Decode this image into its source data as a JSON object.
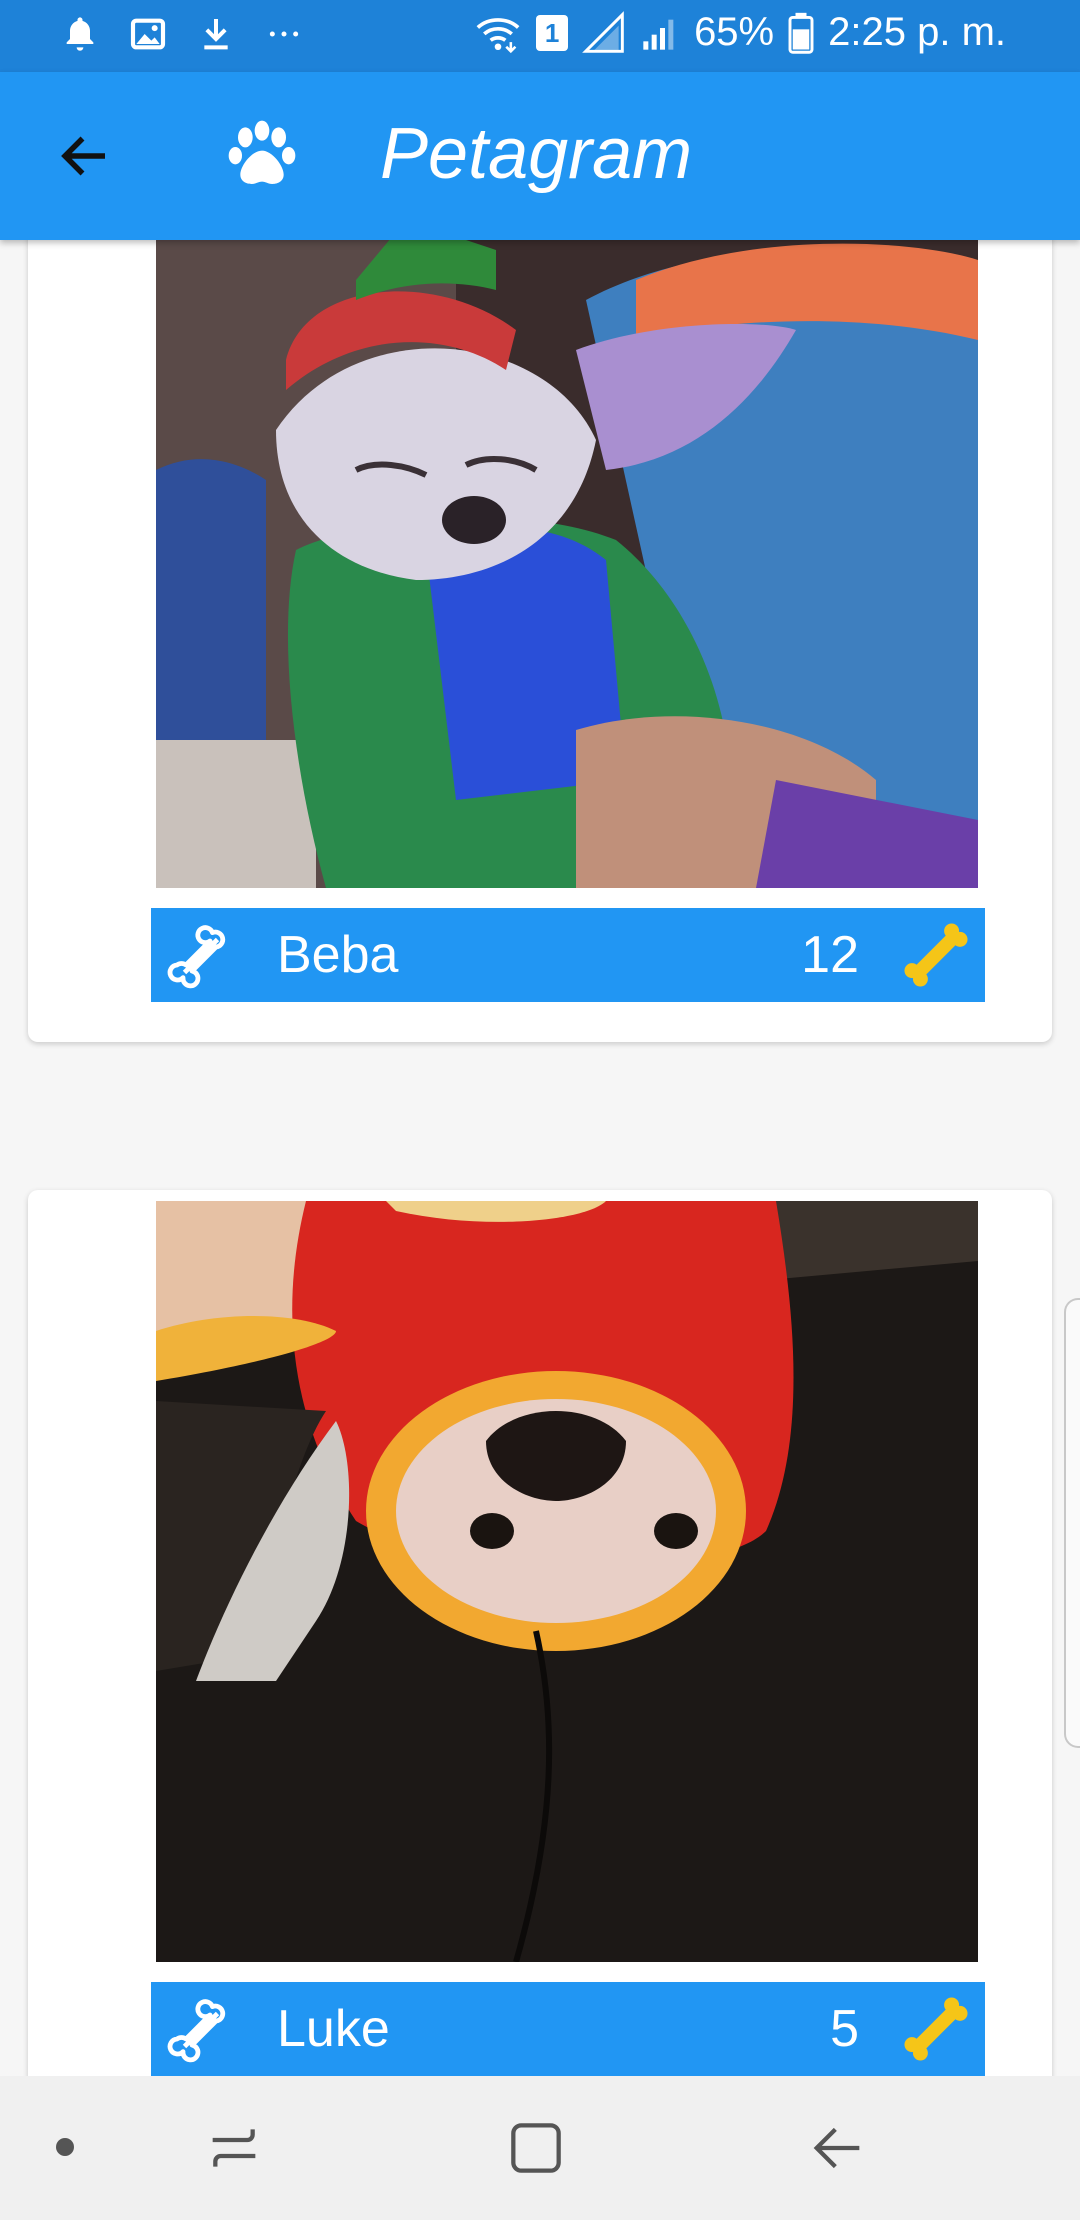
{
  "status_bar": {
    "battery": "65%",
    "time": "2:25 p. m.",
    "sim_badge": "1",
    "icons": [
      "notification-bell-icon",
      "gallery-icon",
      "download-icon",
      "more-dots-icon",
      "wifi-icon",
      "sim-icon",
      "signal-icon",
      "signal-icon",
      "battery-icon"
    ]
  },
  "app_bar": {
    "title": "Petagram",
    "back_icon": "arrow-back-icon",
    "logo_icon": "paw-icon"
  },
  "pets": [
    {
      "name": "Beba",
      "likes": "12",
      "photo": "chihuahua in elf costume"
    },
    {
      "name": "Luke",
      "likes": "5",
      "photo": "chihuahua in red hoodie"
    }
  ],
  "colors": {
    "primary": "#2196f3",
    "primary_dark": "#1e82d8",
    "bone_gold": "#f5c518",
    "card_bg": "#ffffff",
    "page_bg": "#f6f6f6"
  },
  "nav_bar": {
    "buttons": [
      "dot-icon",
      "recents-icon",
      "home-icon",
      "back-icon"
    ]
  }
}
